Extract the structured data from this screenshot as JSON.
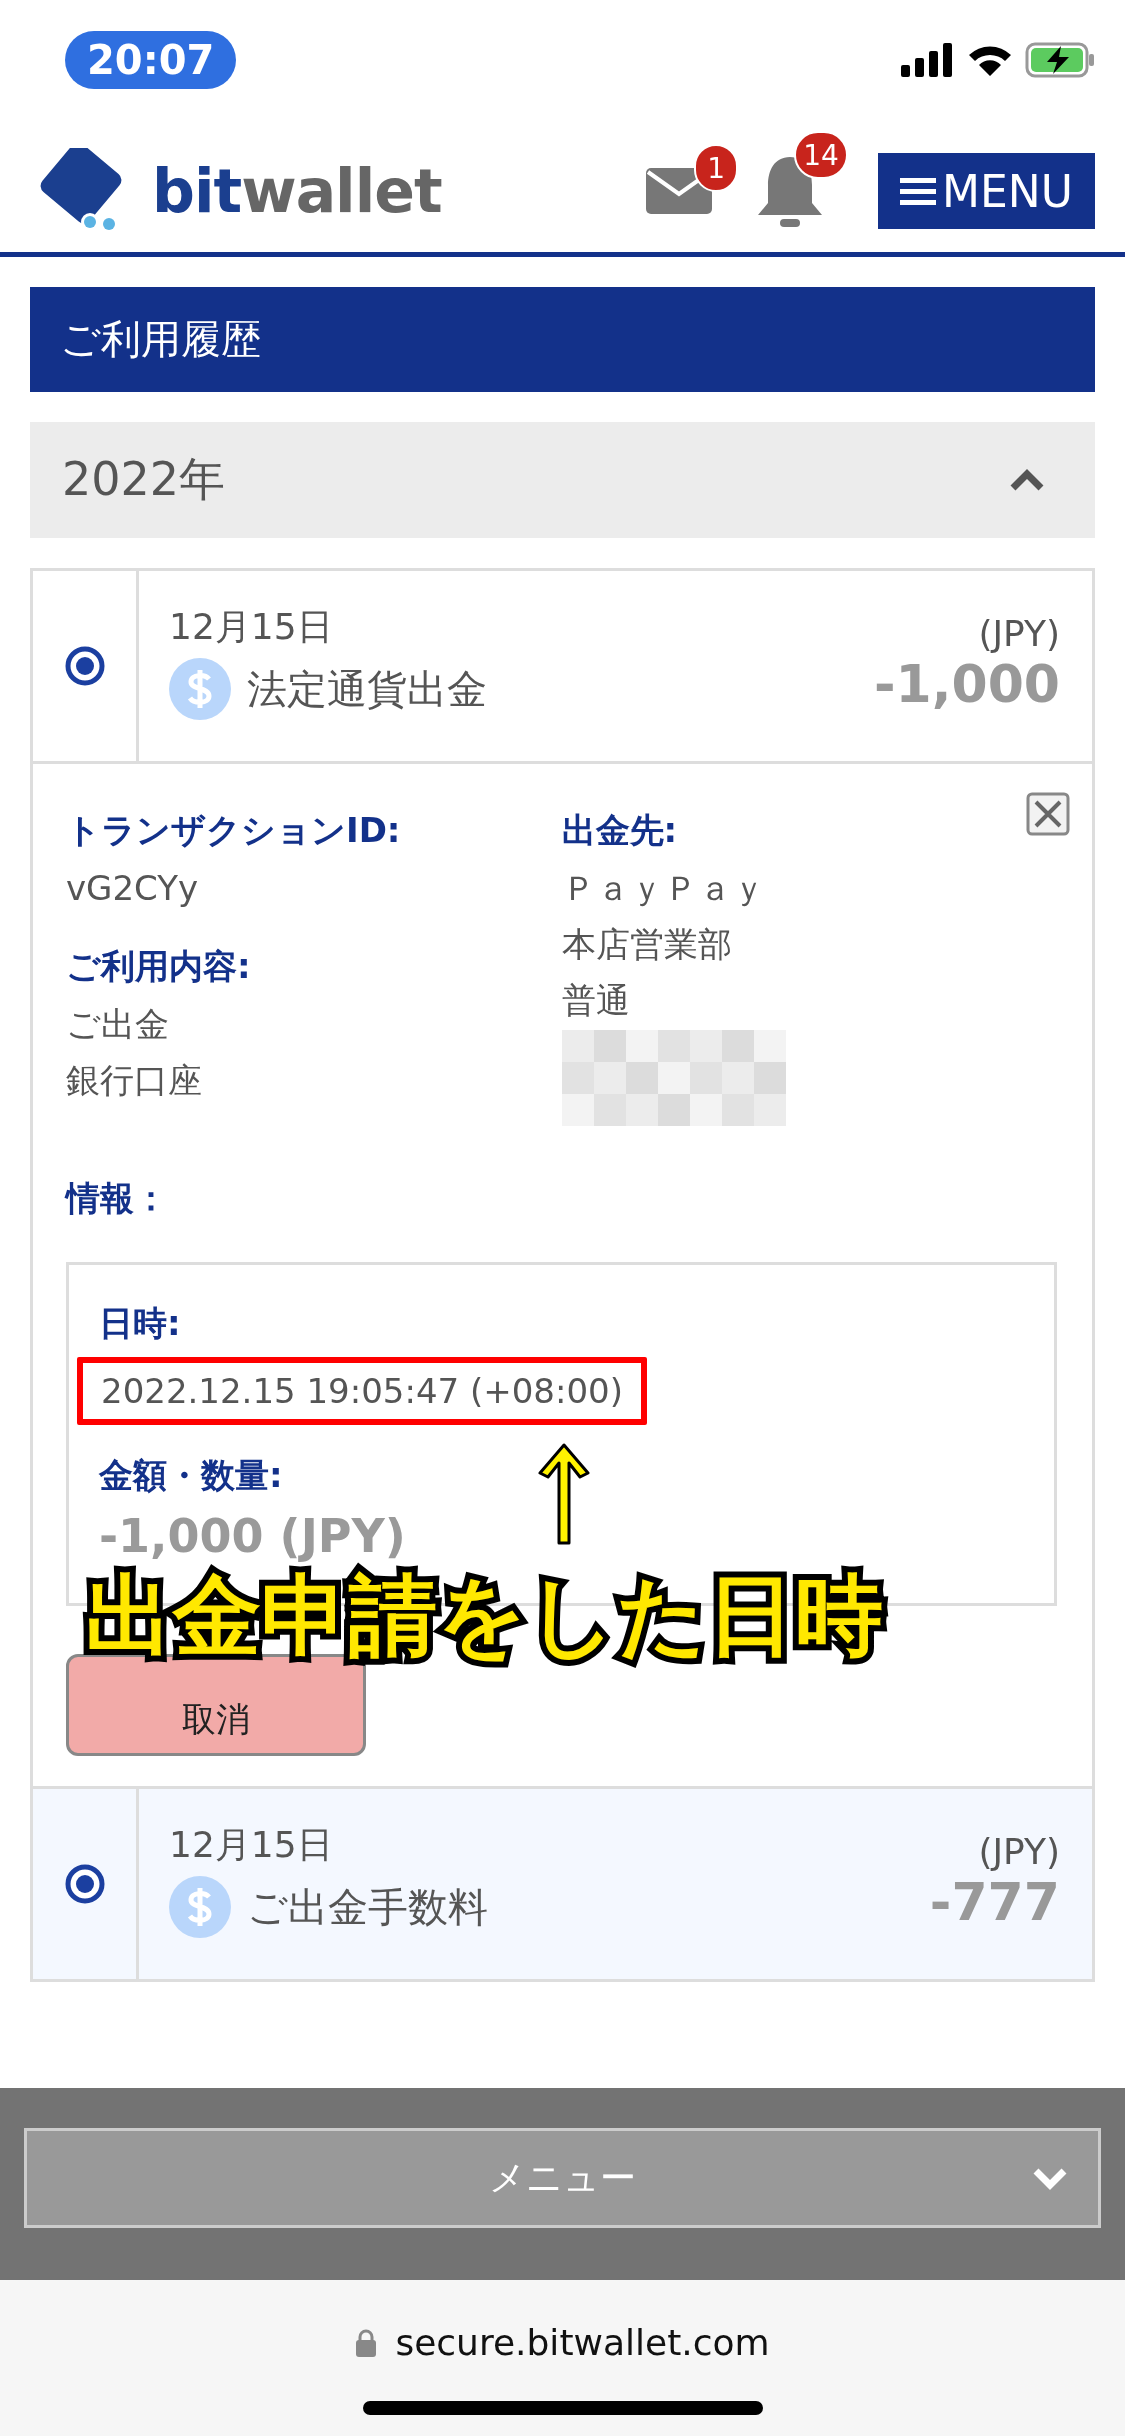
{
  "status_bar": {
    "time": "20:07"
  },
  "header": {
    "brand_parts": [
      "bit",
      "wallet"
    ],
    "mail_badge": "1",
    "bell_badge": "14",
    "menu_button": "MENU"
  },
  "section_title": "ご利用履歴",
  "year_group": {
    "label": "2022年",
    "expanded": true
  },
  "transactions": [
    {
      "date": "12月15日",
      "description": "法定通貨出金",
      "currency": "(JPY)",
      "amount": "-1,000",
      "selected": true,
      "expanded": true,
      "details": {
        "transaction_id_label": "トランザクションID:",
        "transaction_id": "vG2CYy",
        "usage_label": "ご利用内容:",
        "usage_lines": [
          "ご出金",
          "銀行口座"
        ],
        "info_label": "情報：",
        "destination_label": "出金先:",
        "destination_lines": [
          "ＰａｙＰａｙ",
          "本店営業部",
          "普通"
        ],
        "datetime_label": "日時:",
        "datetime": "2022.12.15 19:05:47 (+08:00)",
        "amount_label": "金額・数量:",
        "amount": "-1,000 (JPY)",
        "cancel_button": "取消"
      }
    },
    {
      "date": "12月15日",
      "description": "ご出金手数料",
      "currency": "(JPY)",
      "amount": "-777",
      "selected": true,
      "expanded": false
    }
  ],
  "annotation": {
    "text": "出金申請をした日時"
  },
  "footer": {
    "menu": "メニュー"
  },
  "browser_bar": {
    "url": "secure.bitwallet.com"
  }
}
